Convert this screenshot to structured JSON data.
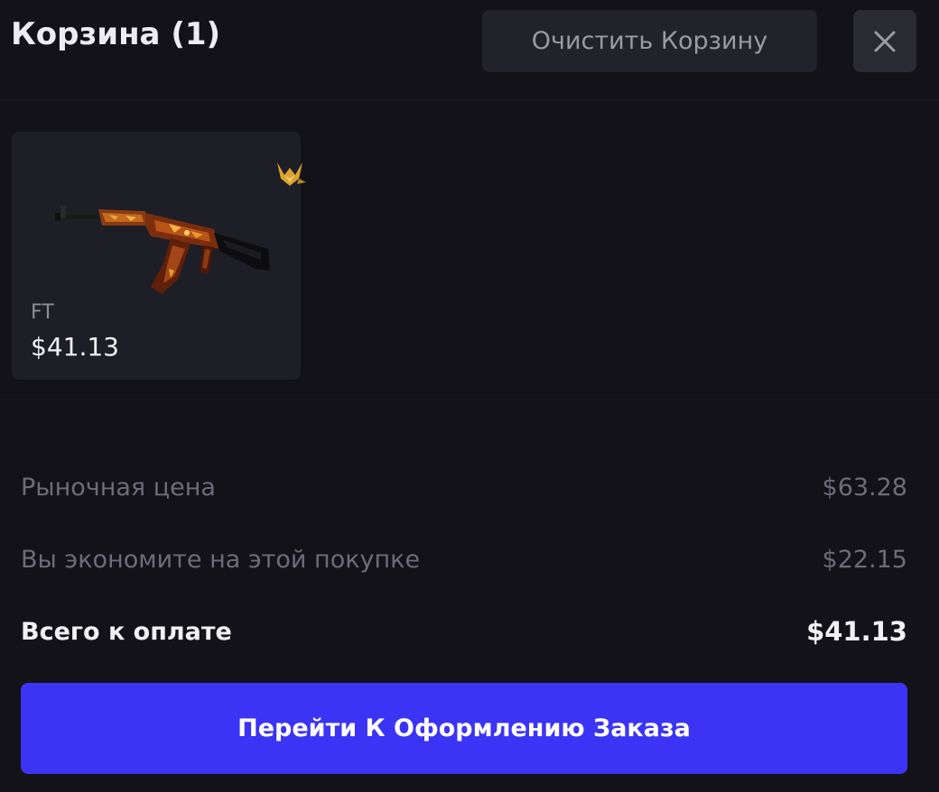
{
  "header": {
    "title": "Корзина (1)",
    "clear_label": "Очистить Корзину",
    "close_icon": "close-icon"
  },
  "items": [
    {
      "wear": "FT",
      "price": "$41.13",
      "badge_icon": "rank-wings-icon",
      "image_icon": "rifle-skin-image"
    }
  ],
  "summary": {
    "market_label": "Рыночная цена",
    "market_value": "$63.28",
    "savings_label": "Вы экономите на этой покупке",
    "savings_value": "$22.15",
    "total_label": "Всего к оплате",
    "total_value": "$41.13"
  },
  "checkout": {
    "label": "Перейти К Оформлению Заказа"
  },
  "colors": {
    "background": "#131218",
    "card": "#1e1e27",
    "accent": "#3b34f4",
    "muted_text": "#6d6c78",
    "badge": "#d9a431"
  }
}
